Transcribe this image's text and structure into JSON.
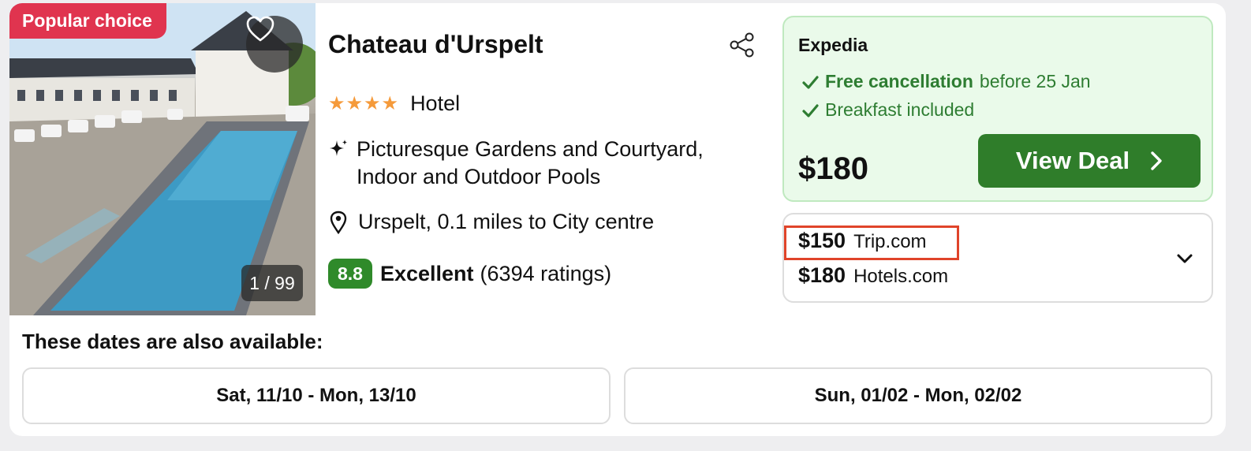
{
  "listing": {
    "badge": "Popular choice",
    "photo_counter": "1 / 99",
    "name": "Chateau d'Urspelt",
    "stars": "★★★★",
    "star_count": 4,
    "type": "Hotel",
    "feature": "Picturesque Gardens and Courtyard, Indoor and Outdoor Pools",
    "location": "Urspelt, 0.1 miles to City centre",
    "rating_score": "8.8",
    "rating_word": "Excellent",
    "rating_count": "(6394 ratings)",
    "icons": {
      "favorite": "heart-icon",
      "share": "share-icon",
      "feature": "sparkle-icon",
      "location": "location-pin-icon"
    }
  },
  "deal": {
    "provider": "Expedia",
    "perks": [
      {
        "strong": "Free cancellation",
        "text": "before 25 Jan"
      },
      {
        "strong": "",
        "text": "Breakfast included"
      }
    ],
    "price": "$180",
    "button_label": "View Deal",
    "colors": {
      "accent_green": "#2f7d2a",
      "deal_bg": "#eafaea",
      "perk_text": "#2e7d32"
    }
  },
  "other_offers": [
    {
      "price": "$150",
      "site": "Trip.com",
      "highlighted": true
    },
    {
      "price": "$180",
      "site": "Hotels.com",
      "highlighted": false
    }
  ],
  "dates": {
    "title": "These dates are also available:",
    "options": [
      "Sat, 11/10 - Mon, 13/10",
      "Sun, 01/02 - Mon, 02/02"
    ]
  },
  "colors": {
    "badge": "#e0344f",
    "star": "#f59a3a",
    "score_bg": "#2f8a2a",
    "highlight_border": "#e0442a"
  }
}
